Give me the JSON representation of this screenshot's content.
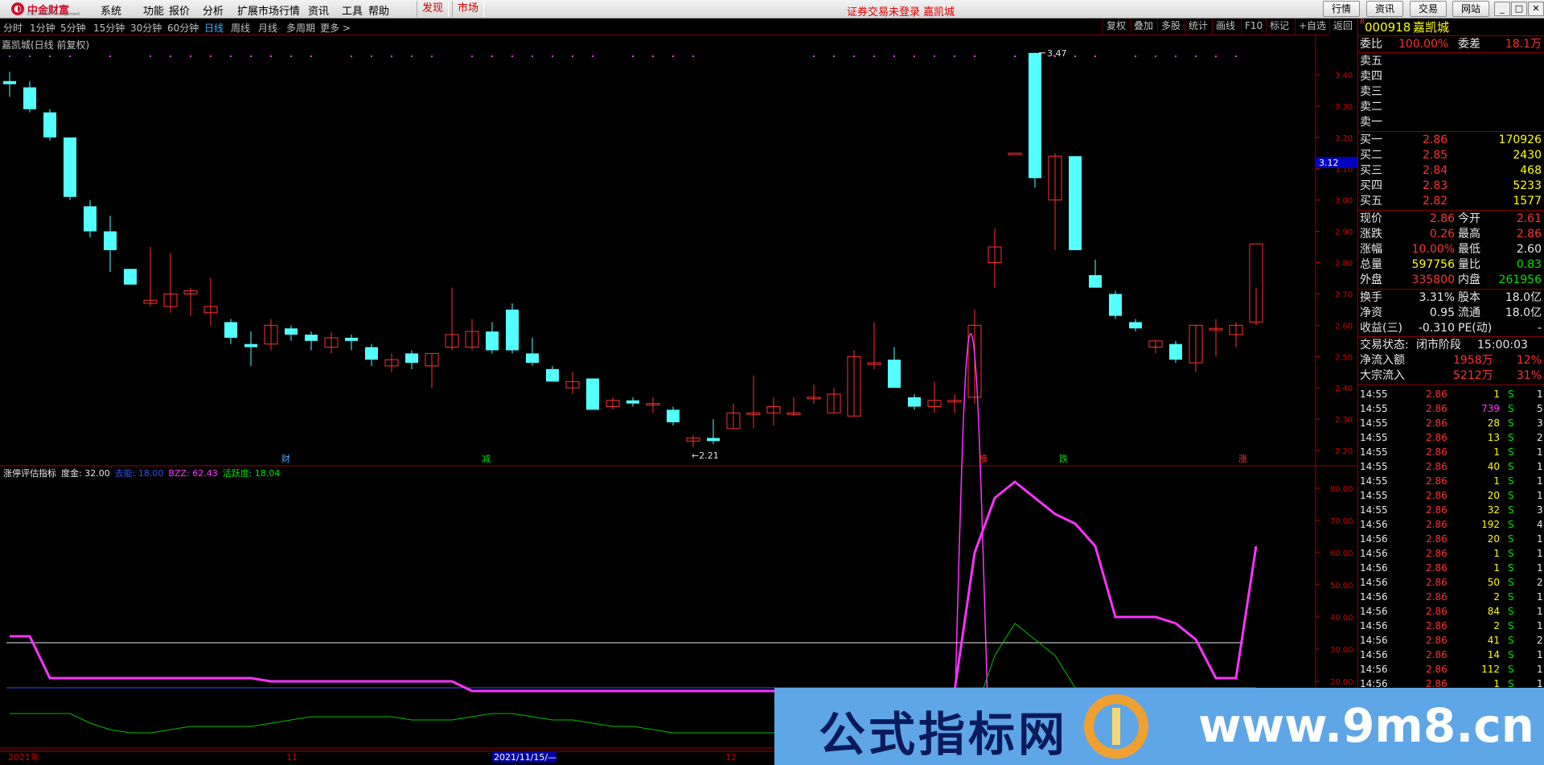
{
  "menubar": {
    "logo_text": "中金财富",
    "logo_sub": "CICC Wealth Management",
    "items": [
      "系统",
      "功能",
      "报价",
      "分析",
      "扩展市场行情",
      "资讯",
      "工具",
      "帮助"
    ],
    "tabs": [
      "发现",
      "市场"
    ],
    "login_status": "证券交易未登录 嘉凯城",
    "top_buttons": [
      "行情",
      "资讯",
      "交易",
      "网站"
    ]
  },
  "periodbar": {
    "periods": [
      "分时",
      "1分钟",
      "5分钟",
      "15分钟",
      "30分钟",
      "60分钟",
      "日线",
      "周线",
      "月线",
      "多周期",
      "更多 >"
    ],
    "active": "日线",
    "right_buttons": [
      "复权",
      "叠加",
      "多股",
      "统计",
      "画线",
      "F10",
      "标记",
      "+自选",
      "返回"
    ]
  },
  "chart": {
    "title": "嘉凯城(日线 前复权)",
    "max_label": "3.47",
    "min_label": "2.21",
    "price_marker": "3.12",
    "y_ticks": [
      "3.40",
      "3.30",
      "3.20",
      "3.10",
      "3.00",
      "2.90",
      "2.80",
      "2.70",
      "2.60",
      "2.50",
      "2.40",
      "2.30",
      "2.20"
    ],
    "events": [
      {
        "label": "财",
        "color": "#4aa8ff"
      },
      {
        "label": "减",
        "color": "#00e000"
      },
      {
        "label": "榜",
        "color": "#ff3030"
      },
      {
        "label": "跌",
        "color": "#00e000"
      },
      {
        "label": "涨",
        "color": "#ff3030"
      }
    ],
    "candles": [
      [
        3.38,
        3.41,
        3.33,
        3.37
      ],
      [
        3.36,
        3.38,
        3.28,
        3.29
      ],
      [
        3.28,
        3.29,
        3.19,
        3.2
      ],
      [
        3.2,
        3.2,
        3.0,
        3.01
      ],
      [
        2.98,
        3.0,
        2.88,
        2.9
      ],
      [
        2.9,
        2.95,
        2.77,
        2.84
      ],
      [
        2.78,
        2.78,
        2.73,
        2.73
      ],
      [
        2.67,
        2.85,
        2.66,
        2.68
      ],
      [
        2.66,
        2.83,
        2.64,
        2.7
      ],
      [
        2.7,
        2.72,
        2.63,
        2.71
      ],
      [
        2.64,
        2.75,
        2.6,
        2.66
      ],
      [
        2.61,
        2.62,
        2.54,
        2.56
      ],
      [
        2.54,
        2.58,
        2.47,
        2.53
      ],
      [
        2.54,
        2.62,
        2.52,
        2.6
      ],
      [
        2.59,
        2.6,
        2.55,
        2.57
      ],
      [
        2.57,
        2.58,
        2.52,
        2.55
      ],
      [
        2.53,
        2.58,
        2.51,
        2.56
      ],
      [
        2.56,
        2.57,
        2.52,
        2.55
      ],
      [
        2.53,
        2.54,
        2.47,
        2.49
      ],
      [
        2.47,
        2.51,
        2.45,
        2.49
      ],
      [
        2.51,
        2.52,
        2.46,
        2.48
      ],
      [
        2.47,
        2.51,
        2.4,
        2.51
      ],
      [
        2.53,
        2.72,
        2.52,
        2.57
      ],
      [
        2.53,
        2.62,
        2.52,
        2.58
      ],
      [
        2.58,
        2.61,
        2.51,
        2.52
      ],
      [
        2.65,
        2.67,
        2.51,
        2.52
      ],
      [
        2.51,
        2.56,
        2.47,
        2.48
      ],
      [
        2.46,
        2.47,
        2.42,
        2.42
      ],
      [
        2.4,
        2.45,
        2.38,
        2.42
      ],
      [
        2.43,
        2.43,
        2.34,
        2.33
      ],
      [
        2.34,
        2.37,
        2.33,
        2.36
      ],
      [
        2.36,
        2.37,
        2.34,
        2.35
      ],
      [
        2.35,
        2.37,
        2.32,
        2.35
      ],
      [
        2.33,
        2.34,
        2.28,
        2.29
      ],
      [
        2.23,
        2.25,
        2.21,
        2.24
      ],
      [
        2.24,
        2.3,
        2.22,
        2.23
      ],
      [
        2.27,
        2.35,
        2.27,
        2.32
      ],
      [
        2.32,
        2.44,
        2.27,
        2.32
      ],
      [
        2.32,
        2.37,
        2.28,
        2.34
      ],
      [
        2.32,
        2.37,
        2.31,
        2.32
      ],
      [
        2.37,
        2.41,
        2.35,
        2.37
      ],
      [
        2.32,
        2.4,
        2.32,
        2.38
      ],
      [
        2.31,
        2.52,
        2.31,
        2.5
      ],
      [
        2.48,
        2.61,
        2.46,
        2.48
      ],
      [
        2.49,
        2.53,
        2.41,
        2.4
      ],
      [
        2.37,
        2.38,
        2.33,
        2.34
      ],
      [
        2.34,
        2.42,
        2.32,
        2.36
      ],
      [
        2.36,
        2.38,
        2.32,
        2.36
      ],
      [
        2.37,
        2.65,
        2.35,
        2.6
      ],
      [
        2.8,
        2.91,
        2.72,
        2.85
      ],
      [
        3.15,
        3.15,
        3.15,
        3.15
      ],
      [
        3.47,
        3.47,
        3.04,
        3.07
      ],
      [
        3.0,
        3.15,
        2.84,
        3.14
      ],
      [
        3.14,
        3.14,
        2.84,
        2.84
      ],
      [
        2.76,
        2.81,
        2.72,
        2.72
      ],
      [
        2.7,
        2.71,
        2.62,
        2.63
      ],
      [
        2.61,
        2.62,
        2.58,
        2.59
      ],
      [
        2.53,
        2.55,
        2.51,
        2.55
      ],
      [
        2.54,
        2.55,
        2.48,
        2.49
      ],
      [
        2.48,
        2.6,
        2.45,
        2.6
      ],
      [
        2.59,
        2.62,
        2.5,
        2.59
      ],
      [
        2.57,
        2.61,
        2.53,
        2.6
      ],
      [
        2.61,
        2.72,
        2.6,
        2.86
      ]
    ],
    "x_labels": [
      "2021年",
      "11",
      "2021/11/15/—",
      "12"
    ]
  },
  "indicator": {
    "title": "涨停评估指标",
    "items": [
      {
        "label": "度金: 32.00",
        "color": "#e8e8e8"
      },
      {
        "label": "去能: 18.00",
        "color": "#3050ff"
      },
      {
        "label": "BZZ: 62.43",
        "color": "#ff33ff"
      },
      {
        "label": "活跃度: 18.04",
        "color": "#00e000"
      }
    ],
    "y_ticks": [
      "80.00",
      "70.00",
      "60.00",
      "50.00",
      "40.00",
      "30.00",
      "20.00"
    ],
    "bzz": [
      34,
      34,
      21,
      21,
      21,
      21,
      21,
      21,
      21,
      21,
      21,
      21,
      21,
      20,
      20,
      20,
      20,
      20,
      20,
      20,
      20,
      20,
      20,
      17,
      17,
      17,
      17,
      17,
      17,
      17,
      17,
      17,
      17,
      17,
      17,
      17,
      17,
      17,
      17,
      17,
      17,
      17,
      17,
      17,
      17,
      17,
      17,
      17,
      60,
      77,
      82,
      77,
      72,
      69,
      62,
      40,
      40,
      40,
      38,
      33,
      21,
      21,
      62
    ],
    "active": [
      10,
      10,
      10,
      10,
      7,
      5,
      4,
      4,
      5,
      6,
      6,
      6,
      6,
      7,
      8,
      9,
      9,
      9,
      9,
      9,
      8,
      8,
      8,
      9,
      10,
      10,
      9,
      8,
      8,
      7,
      6,
      6,
      5,
      4,
      4,
      4,
      4,
      4,
      4,
      4,
      4,
      4,
      4,
      4,
      4,
      4,
      4,
      4,
      10,
      28,
      38,
      33,
      28,
      18,
      18,
      18,
      18,
      18,
      18,
      18,
      18,
      18,
      18
    ]
  },
  "quote": {
    "code": "000918",
    "name": "嘉凯城",
    "badge": "R",
    "wei_bi_label": "委比",
    "wei_bi": "100.00%",
    "wei_cha_label": "委差",
    "wei_cha": "18.1万",
    "sell": [
      {
        "label": "卖五"
      },
      {
        "label": "卖四"
      },
      {
        "label": "卖三"
      },
      {
        "label": "卖二"
      },
      {
        "label": "卖一"
      }
    ],
    "buy": [
      {
        "label": "买一",
        "price": "2.86",
        "vol": "170926"
      },
      {
        "label": "买二",
        "price": "2.85",
        "vol": "2430"
      },
      {
        "label": "买三",
        "price": "2.84",
        "vol": "468"
      },
      {
        "label": "买四",
        "price": "2.83",
        "vol": "5233"
      },
      {
        "label": "买五",
        "price": "2.82",
        "vol": "1577"
      }
    ],
    "stats": [
      {
        "l1": "现价",
        "v1": "2.86",
        "c1": "red",
        "l2": "今开",
        "v2": "2.61",
        "c2": "red"
      },
      {
        "l1": "涨跌",
        "v1": "0.26",
        "c1": "red",
        "l2": "最高",
        "v2": "2.86",
        "c2": "red"
      },
      {
        "l1": "涨幅",
        "v1": "10.00%",
        "c1": "red",
        "l2": "最低",
        "v2": "2.60",
        "c2": "white"
      },
      {
        "l1": "总量",
        "v1": "597756",
        "c1": "yellow",
        "l2": "量比",
        "v2": "0.83",
        "c2": "green"
      },
      {
        "l1": "外盘",
        "v1": "335800",
        "c1": "red",
        "l2": "内盘",
        "v2": "261956",
        "c2": "green"
      }
    ],
    "fund": [
      {
        "l1": "换手",
        "v1": "3.31%",
        "l2": "股本",
        "v2": "18.0亿"
      },
      {
        "l1": "净资",
        "v1": "0.95",
        "l2": "流通",
        "v2": "18.0亿"
      },
      {
        "l1": "收益(三)",
        "v1": "-0.310",
        "l2": "PE(动)",
        "v2": "-"
      }
    ],
    "trade_status_label": "交易状态:",
    "trade_status": "闭市阶段",
    "trade_time": "15:00:03",
    "net_inflow_label": "净流入额",
    "net_inflow": "1958万",
    "net_inflow_pct": "12%",
    "block_label": "大宗流入",
    "block": "5212万",
    "block_pct": "31%"
  },
  "ticks": [
    [
      "14:55",
      "2.86",
      "1",
      "S",
      "1"
    ],
    [
      "14:55",
      "2.86",
      "739",
      "S",
      "5"
    ],
    [
      "14:55",
      "2.86",
      "28",
      "S",
      "3"
    ],
    [
      "14:55",
      "2.86",
      "13",
      "S",
      "2"
    ],
    [
      "14:55",
      "2.86",
      "1",
      "S",
      "1"
    ],
    [
      "14:55",
      "2.86",
      "40",
      "S",
      "1"
    ],
    [
      "14:55",
      "2.86",
      "1",
      "S",
      "1"
    ],
    [
      "14:55",
      "2.86",
      "20",
      "S",
      "1"
    ],
    [
      "14:55",
      "2.86",
      "32",
      "S",
      "3"
    ],
    [
      "14:56",
      "2.86",
      "192",
      "S",
      "4"
    ],
    [
      "14:56",
      "2.86",
      "20",
      "S",
      "1"
    ],
    [
      "14:56",
      "2.86",
      "1",
      "S",
      "1"
    ],
    [
      "14:56",
      "2.86",
      "1",
      "S",
      "1"
    ],
    [
      "14:56",
      "2.86",
      "50",
      "S",
      "2"
    ],
    [
      "14:56",
      "2.86",
      "2",
      "S",
      "1"
    ],
    [
      "14:56",
      "2.86",
      "84",
      "S",
      "1"
    ],
    [
      "14:56",
      "2.86",
      "2",
      "S",
      "1"
    ],
    [
      "14:56",
      "2.86",
      "41",
      "S",
      "2"
    ],
    [
      "14:56",
      "2.86",
      "14",
      "S",
      "1"
    ],
    [
      "14:56",
      "2.86",
      "112",
      "S",
      "1"
    ],
    [
      "14:56",
      "2.86",
      "1",
      "S",
      "1"
    ]
  ],
  "watermark": {
    "text": "公式指标网",
    "url": "www.9m8.cn"
  },
  "colors": {
    "up": "#ff3030",
    "down": "#54ffff",
    "bzz": "#ff33ff",
    "active": "#00c000",
    "base": "#ffffff",
    "divider": "#800000"
  }
}
